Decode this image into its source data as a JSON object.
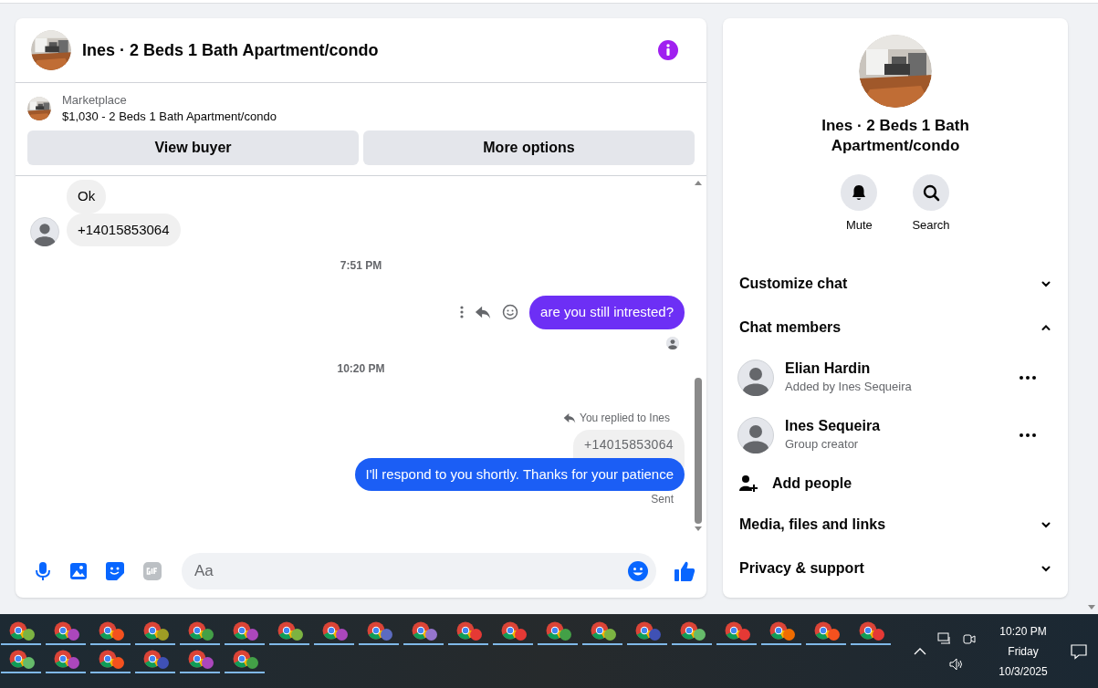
{
  "chat": {
    "title": "Ines · 2 Beds 1 Bath Apartment/condo",
    "listing": {
      "source": "Marketplace",
      "description": "$1,030 - 2 Beds 1 Bath Apartment/condo"
    },
    "buttons": [
      "View buyer",
      "More options"
    ],
    "messages": [
      {
        "kind": "incoming",
        "text": "Ok",
        "avatar": false
      },
      {
        "kind": "incoming",
        "text": "+14015853064",
        "avatar": true
      },
      {
        "kind": "timestamp",
        "text": "7:51 PM"
      },
      {
        "kind": "outgoing",
        "text": "are you still intrested?",
        "color": "#6d2ff5",
        "actions": true
      },
      {
        "kind": "seen"
      },
      {
        "kind": "timestamp",
        "text": "10:20 PM"
      },
      {
        "kind": "reply",
        "label": "You replied to Ines",
        "quoted": "+14015853064",
        "text": "I'll respond to you shortly. Thanks for your patience",
        "color": "#1b5ef5"
      },
      {
        "kind": "status",
        "text": "Sent"
      }
    ],
    "composer": {
      "placeholder": "Aa"
    }
  },
  "details": {
    "title": "Ines · 2 Beds 1 Bath Apartment/condo",
    "actions": [
      {
        "kind": "mute",
        "label": "Mute"
      },
      {
        "kind": "search",
        "label": "Search"
      }
    ],
    "sections": [
      {
        "kind": "section",
        "label": "Customize chat",
        "expanded": false
      },
      {
        "kind": "section",
        "label": "Chat members",
        "expanded": true
      },
      {
        "kind": "member",
        "name": "Elian Hardin",
        "role": "Added by Ines Sequeira"
      },
      {
        "kind": "member",
        "name": "Ines Sequeira",
        "role": "Group creator"
      },
      {
        "kind": "add",
        "label": "Add people"
      },
      {
        "kind": "section",
        "label": "Media, files and links",
        "expanded": false
      },
      {
        "kind": "section",
        "label": "Privacy & support",
        "expanded": false
      }
    ]
  },
  "taskbar": {
    "apps": [
      {
        "color": "#7cb342"
      },
      {
        "color": "#ab47bc"
      },
      {
        "color": "#f4511e"
      },
      {
        "color": "#9e9d24"
      },
      {
        "color": "#43a047"
      },
      {
        "color": "#ab47bc"
      },
      {
        "color": "#7cb342"
      },
      {
        "color": "#ab47bc"
      },
      {
        "color": "#5c6bc0"
      },
      {
        "color": "#9575cd"
      },
      {
        "color": "#e53935"
      },
      {
        "color": "#e53935"
      },
      {
        "color": "#43a047"
      },
      {
        "color": "#7cb342"
      },
      {
        "color": "#3f51b5"
      },
      {
        "color": "#66bb6a"
      },
      {
        "color": "#e53935"
      },
      {
        "color": "#ef6c00"
      },
      {
        "color": "#f4511e"
      },
      {
        "color": "#e53935"
      },
      {
        "color": "#66bb6a"
      },
      {
        "color": "#ab47bc"
      },
      {
        "color": "#f4511e"
      },
      {
        "color": "#3f51b5"
      },
      {
        "color": "#ab47bc"
      },
      {
        "color": "#43a047"
      }
    ],
    "time": "10:20 PM",
    "day": "Friday",
    "date": "10/3/2025"
  }
}
